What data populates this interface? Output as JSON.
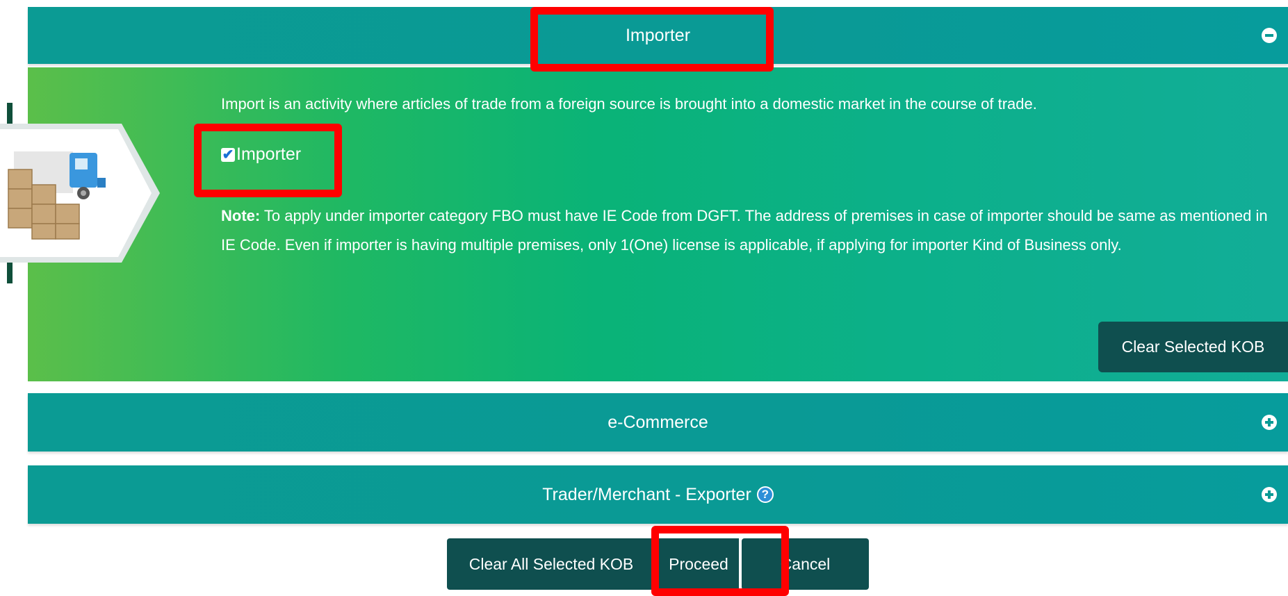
{
  "importer_section": {
    "title": "Importer",
    "toggle_icon": "minus-circle-icon",
    "description": "Import is an activity where articles of trade from a foreign source is brought into a domestic market in the course of trade.",
    "checkbox_label": "Importer",
    "checkbox_checked": true,
    "note_label": "Note:",
    "note_text": " To apply under importer category FBO must have IE Code from DGFT. The address of premises in case of importer should be same as mentioned in IE Code. Even if importer is having multiple premises, only 1(One) license is applicable, if applying for importer Kind of Business only.",
    "clear_button": "Clear Selected KOB",
    "icon": "delivery-truck-boxes-icon"
  },
  "ecommerce_section": {
    "title": "e-Commerce",
    "toggle_icon": "plus-circle-icon"
  },
  "trader_section": {
    "title": "Trader/Merchant - Exporter",
    "help_icon_text": "?",
    "toggle_icon": "plus-circle-icon"
  },
  "footer": {
    "clear_all_button": "Clear All Selected KOB",
    "proceed_button": "Proceed",
    "cancel_button": "Cancel"
  },
  "colors": {
    "header_teal": "#0a9a95",
    "button_dark": "#0f4f4f",
    "highlight_red": "#ff0000",
    "panel_green": "#0ab377"
  }
}
